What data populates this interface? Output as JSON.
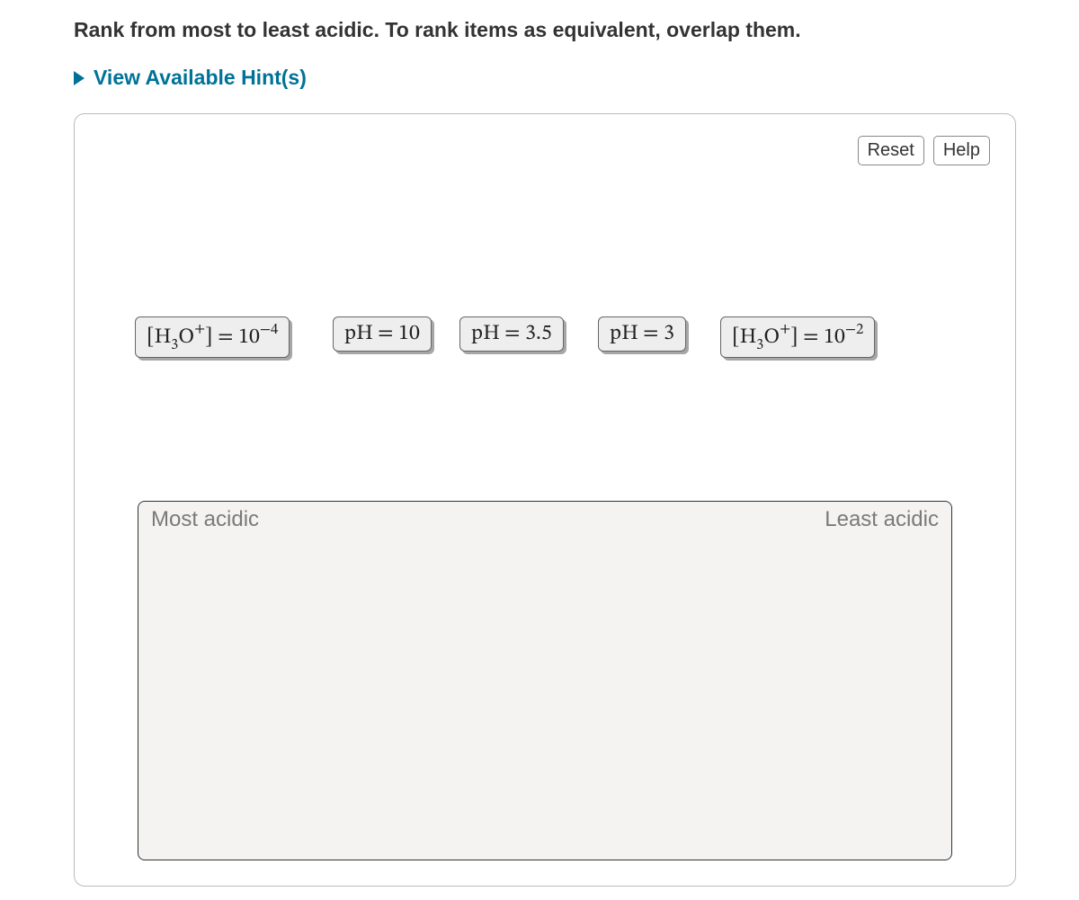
{
  "prompt": "Rank from most to least acidic. To rank items as equivalent, overlap them.",
  "hints_toggle": "View Available Hint(s)",
  "toolbar": {
    "reset": "Reset",
    "help": "Help"
  },
  "chips": {
    "c1": {
      "prefix": "[H",
      "sub": "3",
      "mid": "O",
      "sup": "+",
      "after": "] = 10",
      "negsup": "−4"
    },
    "c2": {
      "text": "pH = 10"
    },
    "c3": {
      "text": "pH = 3.5"
    },
    "c4": {
      "text": "pH = 3"
    },
    "c5": {
      "prefix": "[H",
      "sub": "3",
      "mid": "O",
      "sup": "+",
      "after": "] = 10",
      "negsup": "−2"
    }
  },
  "dropzone": {
    "left": "Most acidic",
    "right": "Least acidic"
  }
}
